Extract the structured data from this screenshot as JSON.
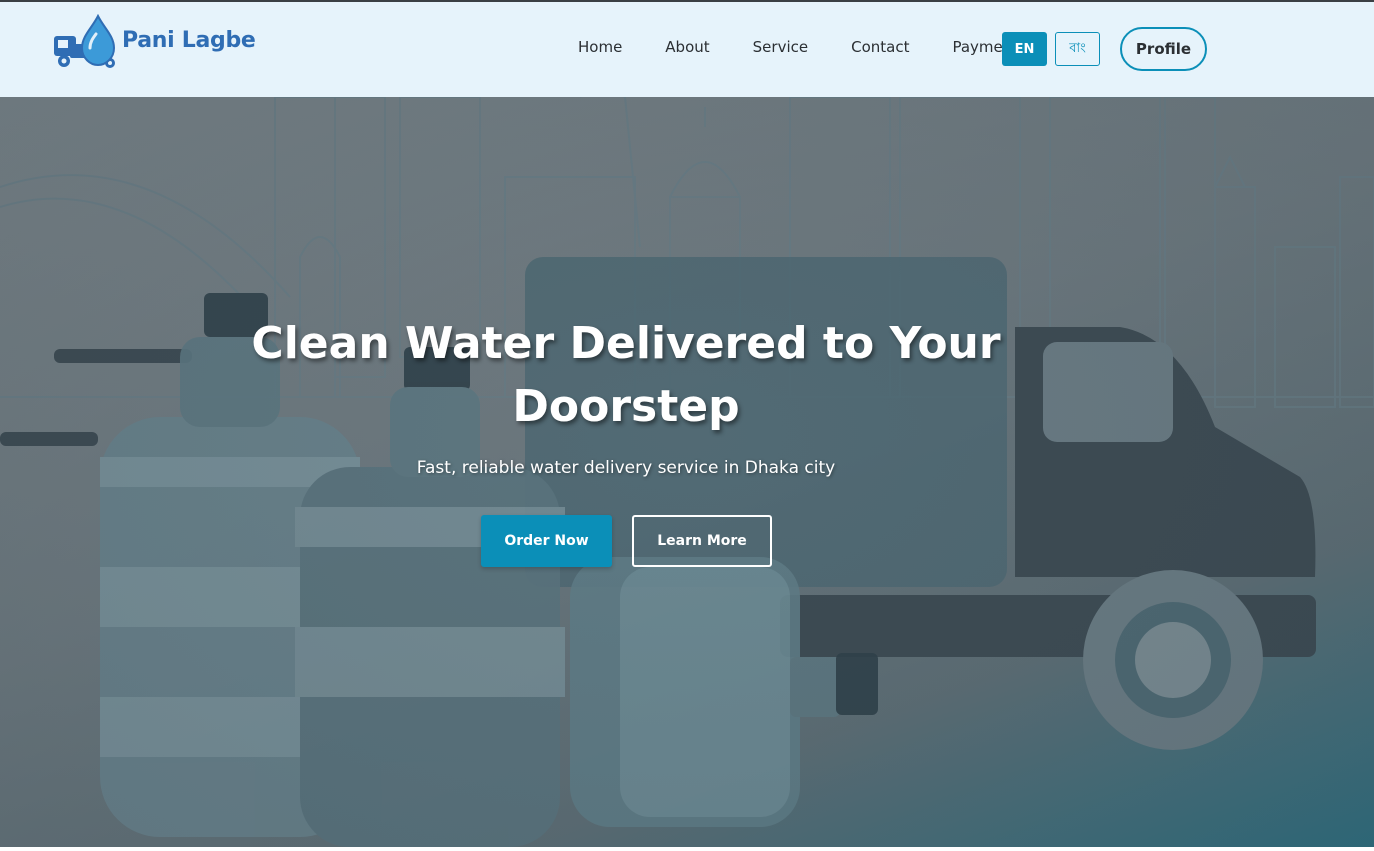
{
  "brand": {
    "name": "Pani Lagbe",
    "logo_icon": "water-truck-drop-icon",
    "color": "#2f6db4"
  },
  "nav": {
    "links": [
      "Home",
      "About",
      "Service",
      "Contact",
      "Payment"
    ],
    "lang_en": "EN",
    "lang_bn": "বাং",
    "profile_label": "Profile"
  },
  "hero": {
    "title": "Clean Water Delivered to Your Doorstep",
    "subtitle": "Fast, reliable water delivery service in Dhaka city",
    "order_button": "Order Now",
    "learn_button": "Learn More",
    "background_icon": "city-skyline-truck-water-jugs-illustration"
  },
  "colors": {
    "accent": "#0b8fb8",
    "navbar_bg": "#e6f3fb",
    "nav_text": "#2b2f33"
  }
}
